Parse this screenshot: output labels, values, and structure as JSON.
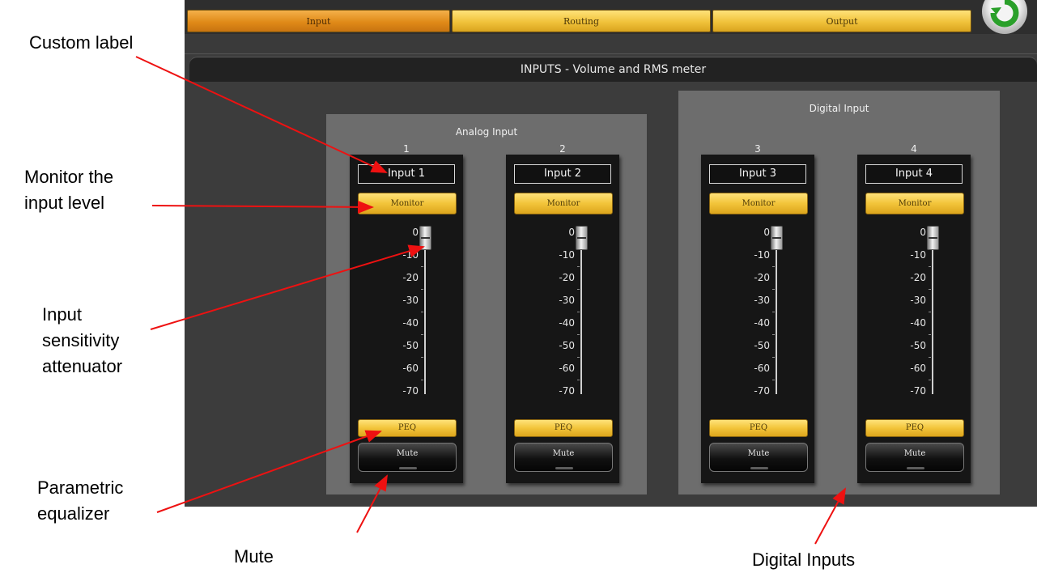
{
  "tabs": [
    {
      "label": "Input",
      "active": true
    },
    {
      "label": "Routing",
      "active": false
    },
    {
      "label": "Output",
      "active": false
    }
  ],
  "title": "INPUTS - Volume and RMS meter",
  "groups": {
    "analog": {
      "title": "Analog Input"
    },
    "digital": {
      "title": "Digital Input"
    }
  },
  "buttons": {
    "monitor": "Monitor",
    "peq": "PEQ",
    "mute": "Mute"
  },
  "channels": [
    {
      "number": "1",
      "name": "Input 1",
      "level_db": 0
    },
    {
      "number": "2",
      "name": "Input 2",
      "level_db": 0
    },
    {
      "number": "3",
      "name": "Input 3",
      "level_db": 0
    },
    {
      "number": "4",
      "name": "Input 4",
      "level_db": 0
    }
  ],
  "fader_scale": [
    "0",
    "-10",
    "-20",
    "-30",
    "-40",
    "-50",
    "-60",
    "-70"
  ],
  "annotations": {
    "custom_label": "Custom label",
    "monitor": "Monitor the input level",
    "attenuator": "Input sensitivity attenuator",
    "peq": "Parametric equalizer",
    "mute": "Mute",
    "digital": "Digital Inputs"
  },
  "colors": {
    "accent_gold": "#f0c23a",
    "active_tab": "#e08a18",
    "arrow": "#ee1111",
    "panel": "#6d6d6d",
    "strip": "#161616"
  },
  "icons": {
    "refresh": "refresh-icon"
  }
}
